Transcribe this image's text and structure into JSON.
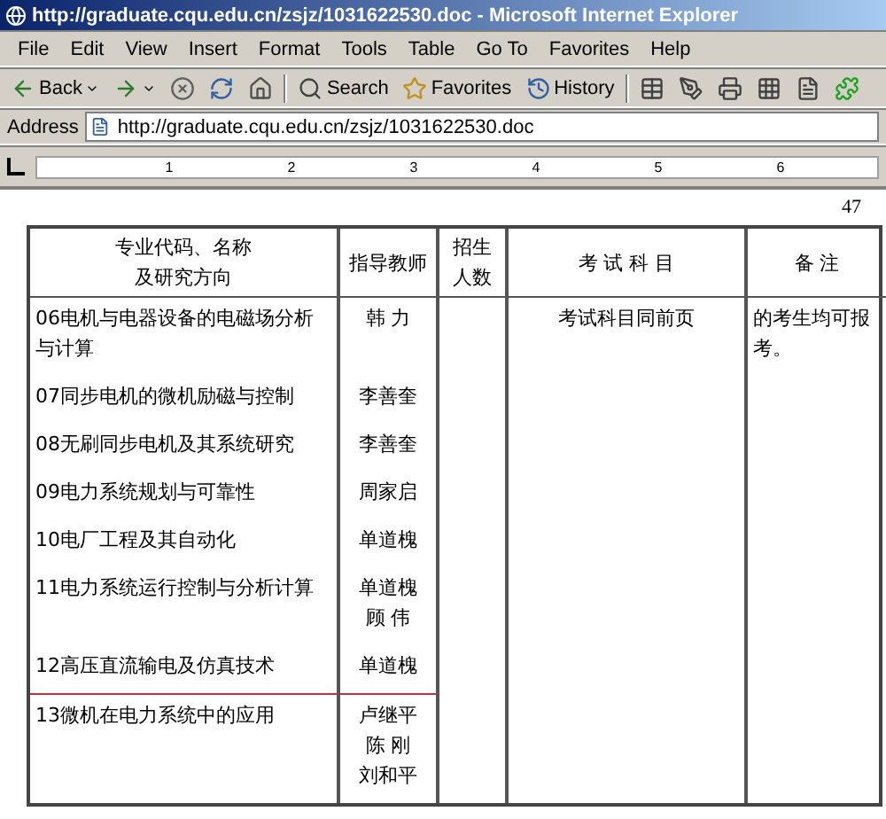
{
  "window": {
    "title": "http://graduate.cqu.edu.cn/zsjz/1031622530.doc - Microsoft Internet Explorer"
  },
  "menu": [
    "File",
    "Edit",
    "View",
    "Insert",
    "Format",
    "Tools",
    "Table",
    "Go To",
    "Favorites",
    "Help"
  ],
  "toolbar": [
    {
      "kind": "back",
      "label": "Back"
    },
    {
      "kind": "forward"
    },
    {
      "kind": "stop"
    },
    {
      "kind": "refresh"
    },
    {
      "kind": "home"
    },
    {
      "kind": "search",
      "label": "Search"
    },
    {
      "kind": "favorites",
      "label": "Favorites"
    },
    {
      "kind": "history",
      "label": "History"
    },
    {
      "kind": "table"
    },
    {
      "kind": "draw"
    },
    {
      "kind": "print"
    },
    {
      "kind": "grid"
    },
    {
      "kind": "page"
    },
    {
      "kind": "plugin"
    }
  ],
  "address": {
    "label": "Address",
    "value": "http://graduate.cqu.edu.cn/zsjz/1031622530.doc"
  },
  "ruler": [
    "1",
    "2",
    "3",
    "4",
    "5",
    "6"
  ],
  "page_number": "47",
  "table": {
    "columns": [
      [
        "专业代码、名称",
        "及研究方向"
      ],
      [
        "指导教师"
      ],
      [
        "招生",
        "人数"
      ],
      [
        "考 试 科 目"
      ],
      [
        "备 注"
      ]
    ],
    "rows": [
      {
        "major": "06电机与电器设备的电磁场分析与计算",
        "teachers": [
          "韩 力"
        ],
        "exam": "考试科目同前页",
        "note": "的考生均可报考。",
        "underlined": false
      },
      {
        "major": "07同步电机的微机励磁与控制",
        "teachers": [
          "李善奎"
        ],
        "underlined": false
      },
      {
        "major": "08无刷同步电机及其系统研究",
        "teachers": [
          "李善奎"
        ],
        "underlined": false
      },
      {
        "major": "09电力系统规划与可靠性",
        "teachers": [
          "周家启"
        ],
        "underlined": false
      },
      {
        "major": "10电厂工程及其自动化",
        "teachers": [
          "单道槐"
        ],
        "underlined": false
      },
      {
        "major": "11电力系统运行控制与分析计算",
        "teachers": [
          "单道槐",
          "顾 伟"
        ],
        "underlined": false
      },
      {
        "major": "12高压直流输电及仿真技术",
        "teachers": [
          "单道槐"
        ],
        "underlined": true
      },
      {
        "major": "13微机在电力系统中的应用",
        "teachers": [
          "卢继平",
          "陈 刚",
          "刘和平"
        ],
        "underlined": false
      }
    ]
  }
}
